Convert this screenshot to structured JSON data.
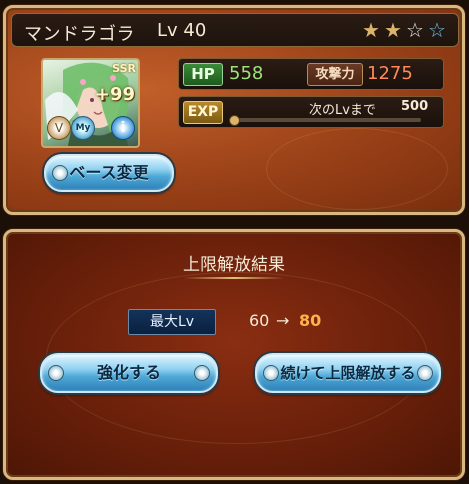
{
  "card": {
    "name": "マンドラゴラ",
    "level": "Lv 40",
    "stars": {
      "filled": 2,
      "total": 4
    },
    "portrait": {
      "rarity": "SSR",
      "plus": "+99",
      "my_badge": "My"
    },
    "hp": {
      "label": "HP",
      "value": "558"
    },
    "attack": {
      "label": "攻撃力",
      "value": "1275"
    },
    "exp": {
      "label": "EXP",
      "next_label": "次のLvまで",
      "next_value": "500",
      "progress": 0.0
    },
    "change_base_label": "ベース変更"
  },
  "result": {
    "title": "上限解放結果",
    "max_lv_label": "最大Lv",
    "lv_from": "60",
    "arrow": "→",
    "lv_to": "80",
    "enhance_label": "強化する",
    "continue_label": "続けて上限解放する"
  },
  "colors": {
    "hp": "#9ee37a",
    "attack": "#ff8a5a",
    "lv_to": "#ffb24a",
    "star_filled": "#d9b46a",
    "star_empty": "#6fc3e8"
  }
}
